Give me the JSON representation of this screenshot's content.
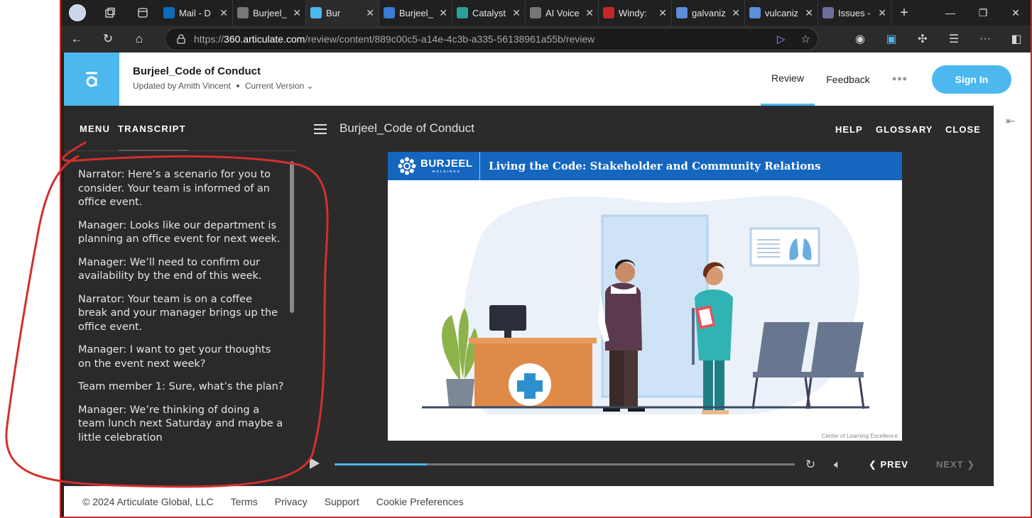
{
  "browser": {
    "tabs": [
      {
        "label": "Mail - D",
        "favicon_color": "#0f6cbd",
        "active": false
      },
      {
        "label": "Burjeel_",
        "favicon_color": "#777777",
        "active": false
      },
      {
        "label": "Bur",
        "favicon_color": "#4db8ef",
        "active": true
      },
      {
        "label": "Burjeel_",
        "favicon_color": "#3a7bd5",
        "active": false
      },
      {
        "label": "Catalyst",
        "favicon_color": "#2aa198",
        "active": false
      },
      {
        "label": "AI Voice",
        "favicon_color": "#777777",
        "active": false
      },
      {
        "label": "Windy:",
        "favicon_color": "#c62828",
        "active": false
      },
      {
        "label": "galvaniz",
        "favicon_color": "#5b8dd9",
        "active": false
      },
      {
        "label": "vulcaniz",
        "favicon_color": "#5b8dd9",
        "active": false
      },
      {
        "label": "Issues -",
        "favicon_color": "#6e6e9e",
        "active": false
      }
    ],
    "url": {
      "scheme": "https://",
      "host": "360.articulate.com",
      "path": "/review/content/889c00c5-a14e-4c3b-a335-56138961a55b/review"
    }
  },
  "header": {
    "doc_title": "Burjeel_Code of Conduct",
    "updated_by": "Updated by Amith Vincent",
    "version": "Current Version",
    "nav_review": "Review",
    "nav_feedback": "Feedback",
    "more": "•••",
    "sign_in": "Sign In"
  },
  "sidebar": {
    "tab_menu": "MENU",
    "tab_transcript": "TRANSCRIPT",
    "transcript": [
      "Narrator: Here’s a scenario for you to consider. Your team is informed of an office event.",
      "Manager: Looks like our department is planning an office event for next week.",
      "Manager: We’ll need to confirm our availability by the end of this week.",
      "Narrator: Your team is on a coffee break and your manager brings up the office event.",
      "Manager: I want to get your thoughts on the event next week?",
      "Team member 1: Sure, what’s the plan?",
      "Manager: We’re thinking of doing a team lunch next Saturday and maybe a little celebration"
    ]
  },
  "stage": {
    "course_title": "Burjeel_Code of Conduct",
    "help": "HELP",
    "glossary": "GLOSSARY",
    "close": "CLOSE",
    "slide": {
      "brand": "BURJEEL",
      "brand_sub": "HOLDINGS",
      "banner_title": "Living the Code: Stakeholder and Community Relations",
      "footer": "Center of Learning Excellence"
    },
    "controls": {
      "progress": 0.2,
      "prev": "PREV",
      "next": "NEXT"
    }
  },
  "footer": {
    "copyright": "© 2024 Articulate Global, LLC",
    "terms": "Terms",
    "privacy": "Privacy",
    "support": "Support",
    "cookies": "Cookie Preferences"
  },
  "colors": {
    "accent": "#4db8ef",
    "banner": "#1466bf",
    "annotation": "#d32f2f"
  }
}
